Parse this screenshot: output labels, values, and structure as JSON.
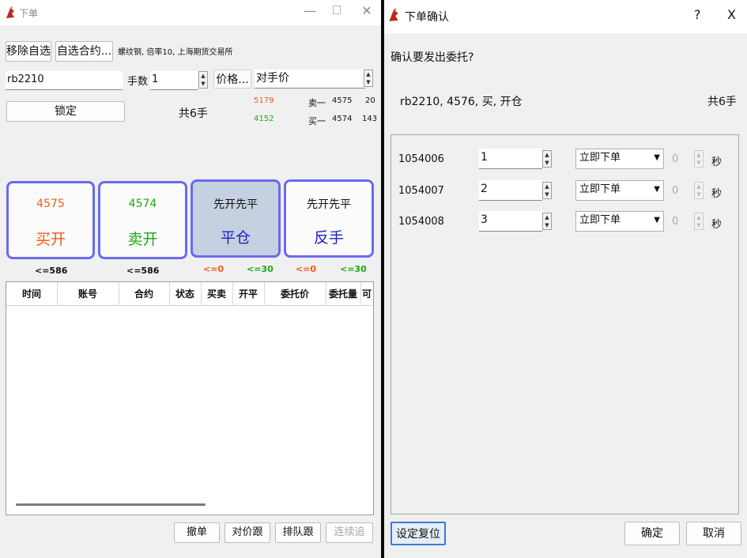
{
  "left": {
    "title": "下单",
    "btn_remove": "移除自选",
    "btn_pick": "自选合约...",
    "info": "螺纹钢, 倍率10, 上海期货交易所",
    "contract": "rb2210",
    "lots_label": "手数",
    "lots_value": "1",
    "price_btn": "价格...",
    "price_mode": "对手价",
    "lock_btn": "锁定",
    "total": "共6手",
    "q_sell_vol_l": "5179",
    "q_sell_label": "卖一",
    "q_sell_price": "4575",
    "q_sell_vol_r": "20",
    "q_buy_vol_l": "4152",
    "q_buy_label": "买一",
    "q_buy_price": "4574",
    "q_buy_vol_r": "143",
    "b1_top": "4575",
    "b1_bot": "买开",
    "b2_top": "4574",
    "b2_bot": "卖开",
    "b3_top": "先开先平",
    "b3_bot": "平仓",
    "b4_top": "先开先平",
    "b4_bot": "反手",
    "cap1": "<=586",
    "cap2": "<=586",
    "cap3a": "<=0",
    "cap3b": "<=30",
    "cap4a": "<=0",
    "cap4b": "<=30",
    "headers": [
      "时间",
      "账号",
      "合约",
      "状态",
      "买卖",
      "开平",
      "委托价",
      "委托量",
      "可"
    ],
    "btn_cancel": "撤单",
    "btn_follow": "对价跟",
    "btn_queue": "排队跟",
    "btn_chase": "连续追"
  },
  "right": {
    "title": "下单确认",
    "help": "?",
    "close": "X",
    "question": "确认要发出委托?",
    "summary": "rb2210, 4576, 买, 开仓",
    "total": "共6手",
    "rows": [
      {
        "account": "1054006",
        "qty": "1",
        "mode": "立即下单",
        "delay": "0",
        "unit": "秒"
      },
      {
        "account": "1054007",
        "qty": "2",
        "mode": "立即下单",
        "delay": "0",
        "unit": "秒"
      },
      {
        "account": "1054008",
        "qty": "3",
        "mode": "立即下单",
        "delay": "0",
        "unit": "秒"
      }
    ],
    "btn_reset": "设定复位",
    "btn_ok": "确定",
    "btn_cancel": "取消"
  },
  "colors": {
    "accent_border": "#6a6af0",
    "sell_red": "#f05a14",
    "buy_green": "#1aaa1a",
    "selected_bg": "#c5d1e0"
  }
}
